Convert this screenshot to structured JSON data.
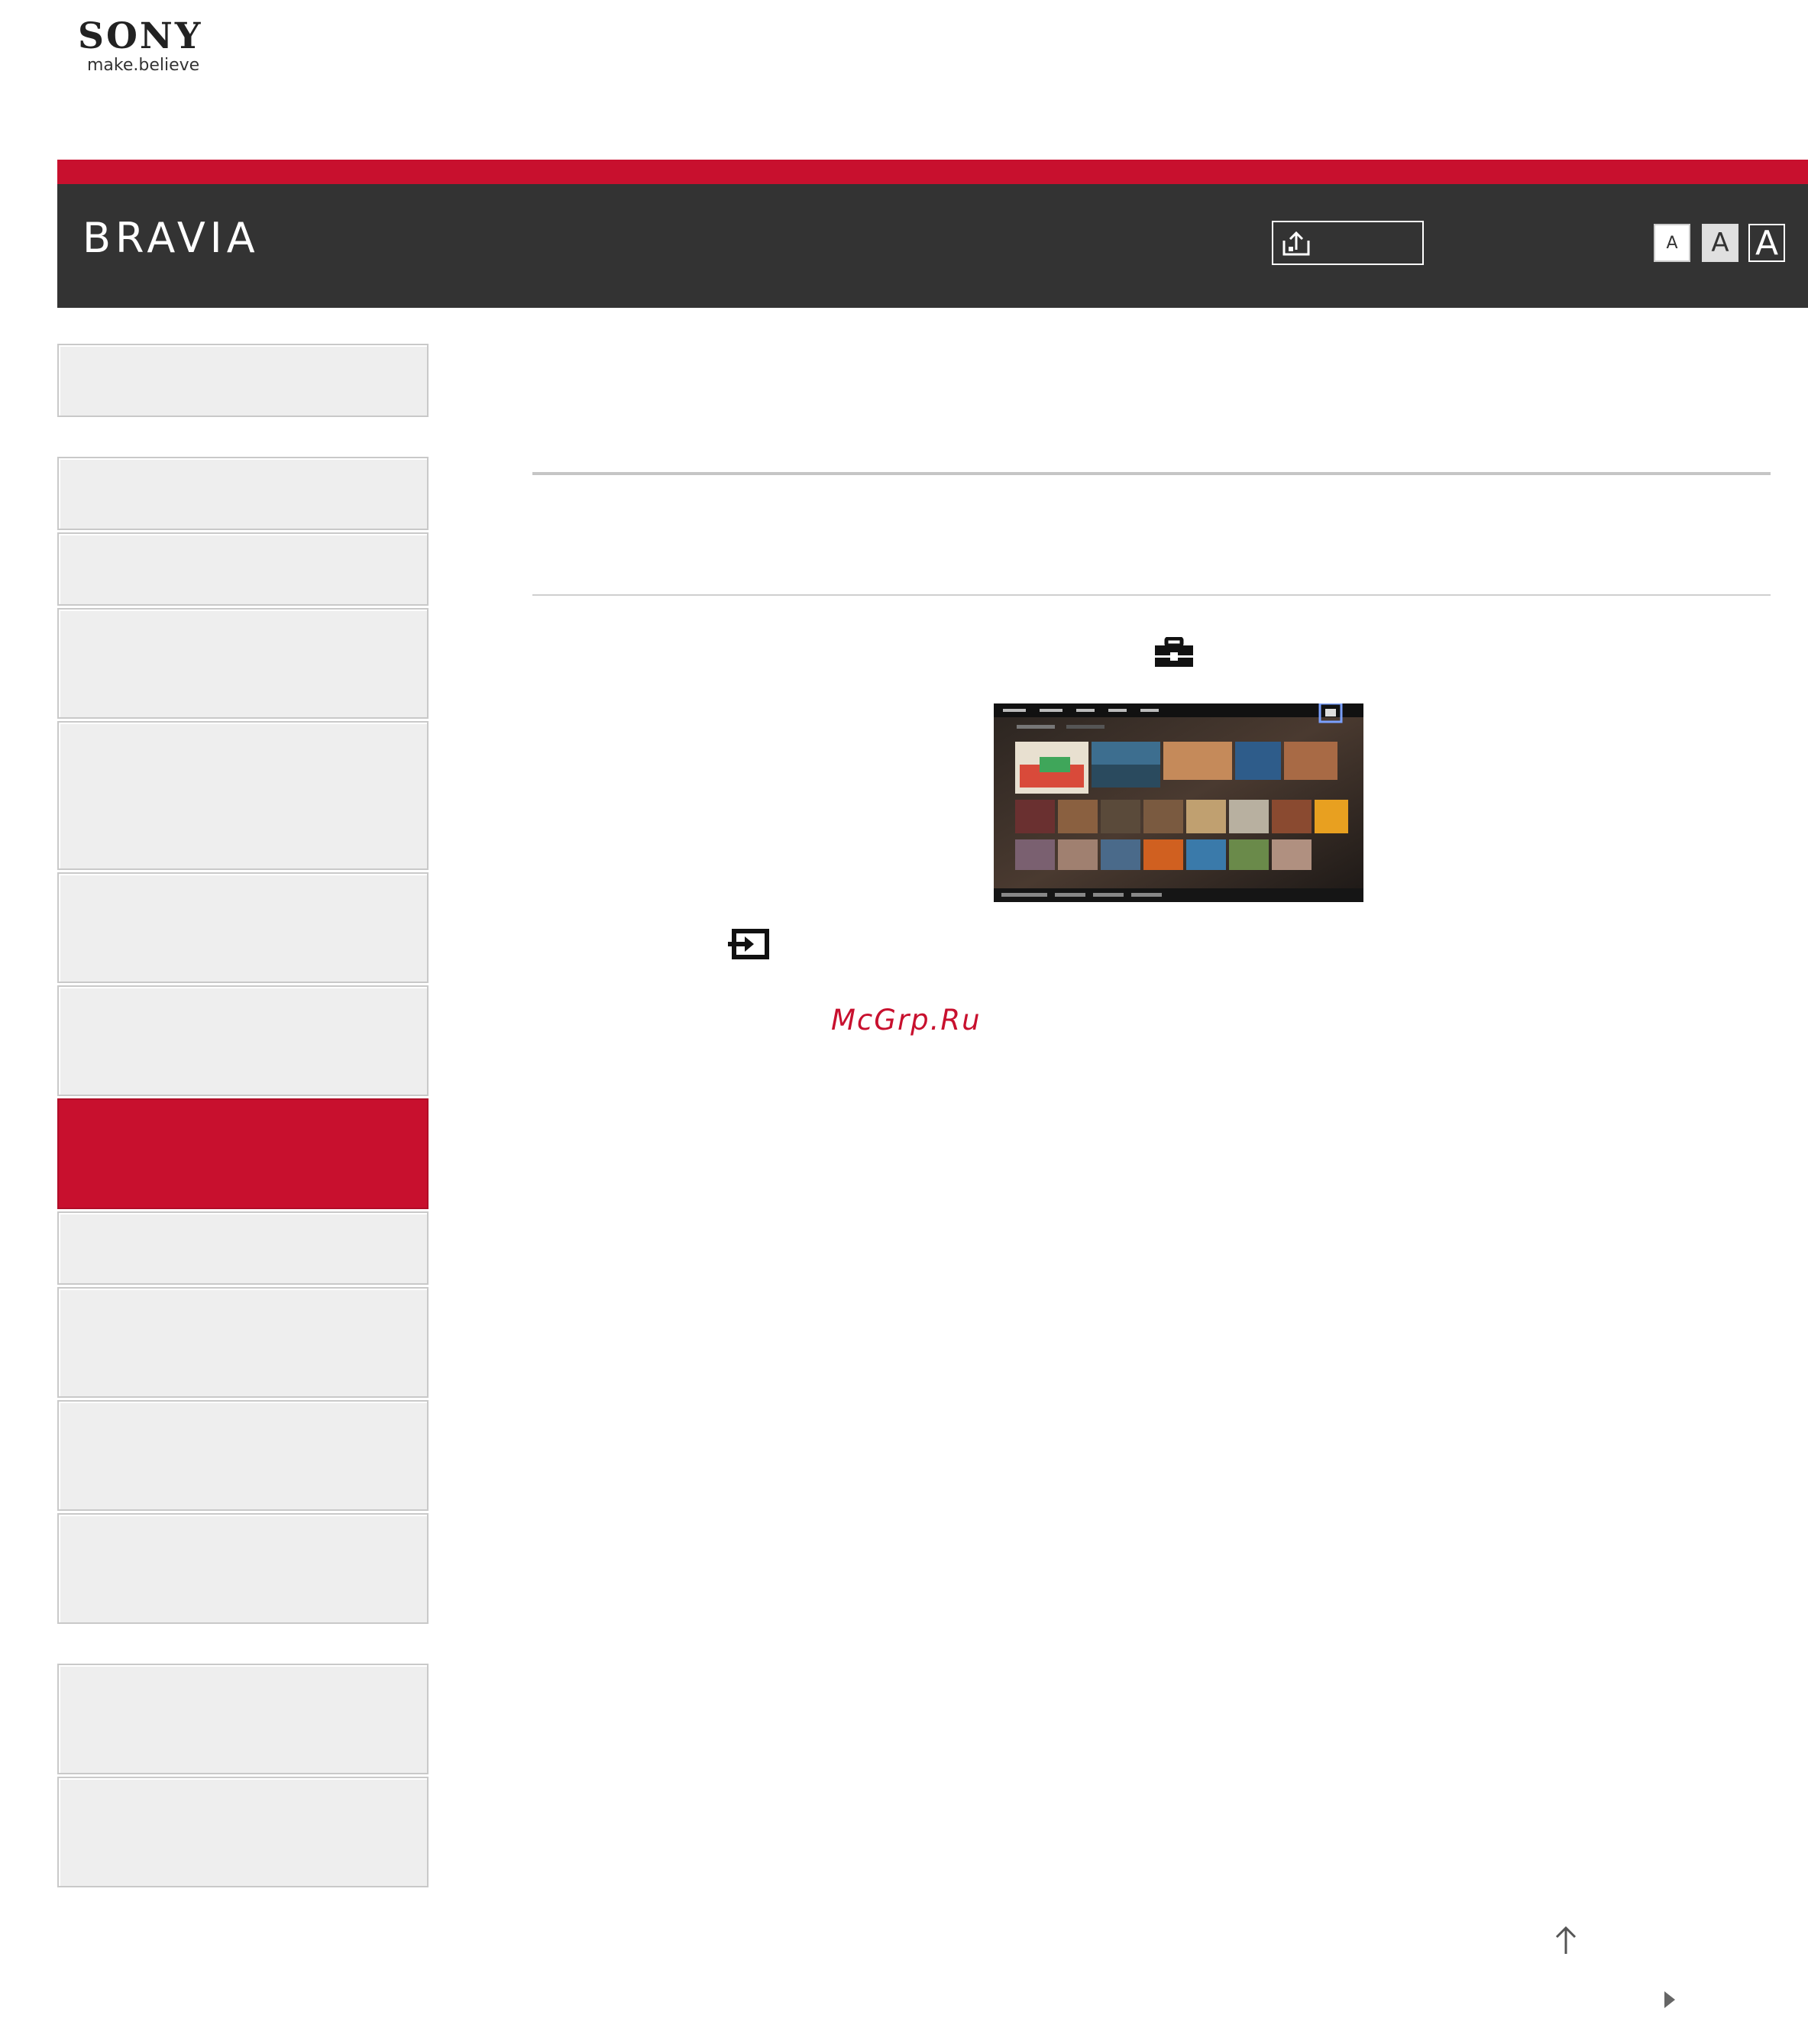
{
  "header": {
    "logo_text": "SONY",
    "tagline": "make.believe",
    "brand": "BRAVIA",
    "font_size_buttons": [
      "A",
      "A",
      "A"
    ]
  },
  "sidebar": {
    "items": [
      {
        "label": "",
        "state": "normal"
      },
      {
        "label": "",
        "state": "normal"
      },
      {
        "label": "",
        "state": "normal"
      },
      {
        "label": "",
        "state": "normal"
      },
      {
        "label": "",
        "state": "normal"
      },
      {
        "label": "",
        "state": "normal"
      },
      {
        "label": "",
        "state": "normal"
      },
      {
        "label": "",
        "state": "active"
      },
      {
        "label": "",
        "state": "normal"
      },
      {
        "label": "",
        "state": "normal"
      },
      {
        "label": "",
        "state": "normal"
      },
      {
        "label": "",
        "state": "normal"
      },
      {
        "label": "",
        "state": "normal"
      },
      {
        "label": "",
        "state": "normal"
      }
    ]
  },
  "content": {
    "watermark": "McGrp.Ru",
    "icons": [
      "toolbox-icon",
      "input-icon",
      "print-share-icon",
      "back-to-top-icon",
      "next-page-icon"
    ]
  },
  "colors": {
    "accent_red": "#c8102e",
    "header_dark": "#333333",
    "sidebar_bg": "#eeeeee",
    "divider": "#c5c5c5"
  }
}
